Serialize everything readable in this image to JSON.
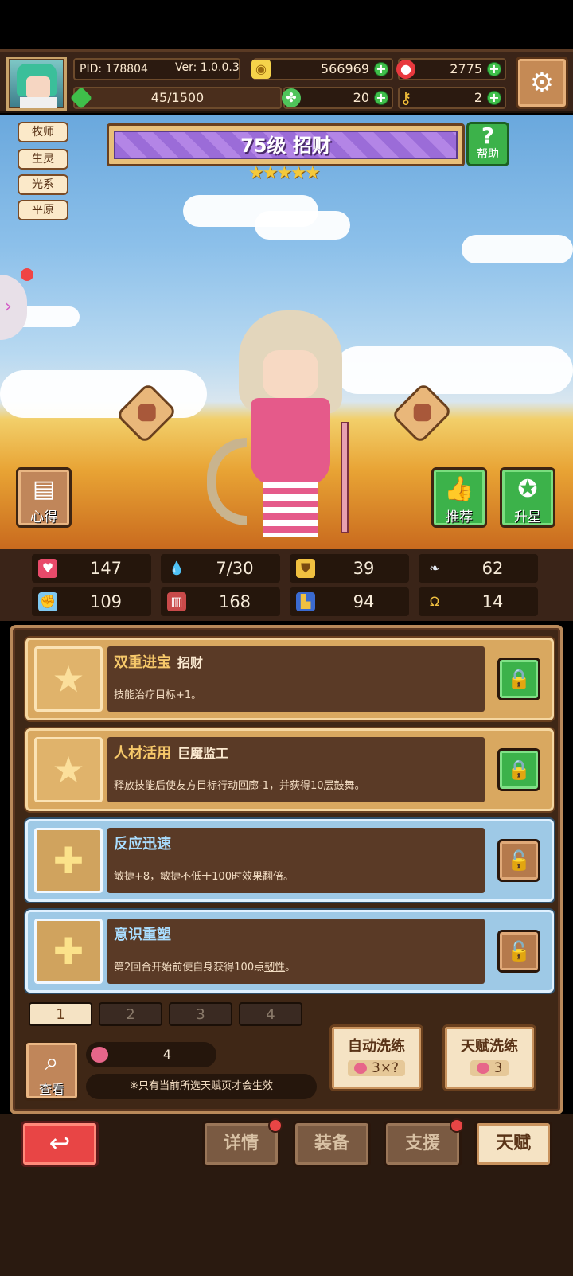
{
  "header": {
    "pid": "PID: 178804",
    "version": "Ver: 1.0.0.3",
    "gold": "566969",
    "gems": "2775",
    "exp": "45/1500",
    "clover": "20",
    "keys": "2"
  },
  "hero": {
    "tags": [
      "牧师",
      "生灵",
      "光系",
      "平原"
    ],
    "title": "75级 招财",
    "stars": "★★★★★",
    "help_label": "帮助",
    "tips_label": "心得",
    "recommend_label": "推荐",
    "star_up_label": "升星"
  },
  "stats": [
    {
      "icon": "heart-icon",
      "value": "147"
    },
    {
      "icon": "water-drop-icon",
      "value": "7/30"
    },
    {
      "icon": "shield-icon",
      "value": "39"
    },
    {
      "icon": "wing-icon",
      "value": "62"
    },
    {
      "icon": "fist-icon",
      "value": "109"
    },
    {
      "icon": "book-icon",
      "value": "168"
    },
    {
      "icon": "boot-icon",
      "value": "94"
    },
    {
      "icon": "horseshoe-icon",
      "value": "14"
    }
  ],
  "talents": [
    {
      "name": "双重进宝",
      "sub": "招财",
      "desc": "技能治疗目标+1。",
      "style": "gold"
    },
    {
      "name": "人材活用",
      "sub": "巨魔监工",
      "desc_pre": "释放技能后使友方目标",
      "desc_u1": "行动回廊",
      "desc_mid": "-1，并获得10层",
      "desc_u2": "鼓舞",
      "desc_post": "。",
      "style": "gold"
    },
    {
      "name": "反应迅速",
      "sub": "",
      "desc": "敏捷+8，敏捷不低于100时效果翻倍。",
      "style": "blue"
    },
    {
      "name": "意识重塑",
      "sub": "",
      "desc_pre": "第2回合开始前使自身获得100点",
      "desc_u1": "韧性",
      "desc_post": "。",
      "style": "blue"
    }
  ],
  "pages": [
    "1",
    "2",
    "3",
    "4"
  ],
  "panel": {
    "view_label": "查看",
    "fruit_count": "4",
    "note": "※只有当前所选天赋页才会生效",
    "auto_refine_label": "自动洗练",
    "auto_refine_cost": "3×?",
    "talent_refine_label": "天赋洗练",
    "talent_refine_cost": "3"
  },
  "nav": {
    "details": "详情",
    "equip": "装备",
    "support": "支援",
    "talent": "天赋"
  },
  "colors": {
    "gold_frame": "#d9a860",
    "blue_frame": "#9ec9e6",
    "accent_green": "#3cb24a",
    "back_red": "#e84545"
  }
}
